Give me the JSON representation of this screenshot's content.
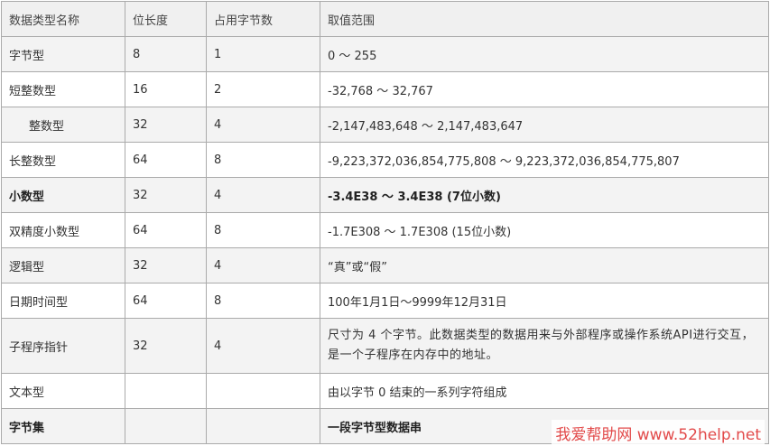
{
  "table": {
    "headers": [
      "数据类型名称",
      "位长度",
      "占用字节数",
      "取值范围"
    ],
    "rows": [
      {
        "name": "字节型",
        "bits": "8",
        "bytes": "1",
        "range": "0 ～ 255"
      },
      {
        "name": "短整数型",
        "bits": "16",
        "bytes": "2",
        "range": "-32,768 ～ 32,767"
      },
      {
        "name": "整数型",
        "bits": "32",
        "bytes": "4",
        "range": "-2,147,483,648 ～ 2,147,483,647"
      },
      {
        "name": "长整数型",
        "bits": "64",
        "bytes": "8",
        "range": "-9,223,372,036,854,775,808 ～ 9,223,372,036,854,775,807"
      },
      {
        "name": "小数型",
        "bits": "32",
        "bytes": "4",
        "range": "-3.4E38 ～ 3.4E38 (7位小数)"
      },
      {
        "name": "双精度小数型",
        "bits": "64",
        "bytes": "8",
        "range": "-1.7E308 ～ 1.7E308 (15位小数)"
      },
      {
        "name": "逻辑型",
        "bits": "32",
        "bytes": "4",
        "range": "“真”或“假”"
      },
      {
        "name": "日期时间型",
        "bits": "64",
        "bytes": "8",
        "range": "100年1月1日～9999年12月31日"
      },
      {
        "name": "子程序指针",
        "bits": "32",
        "bytes": "4",
        "range": "尺寸为 4 个字节。此数据类型的数据用来与外部程序或操作系统API进行交互，是一个子程序在内存中的地址。"
      },
      {
        "name": "文本型",
        "bits": "",
        "bytes": "",
        "range": "由以字节 0 结束的一系列字符组成"
      },
      {
        "name": "字节集",
        "bits": "",
        "bytes": "",
        "range": "一段字节型数据串"
      }
    ]
  },
  "watermark": {
    "text": "我爱帮助网 www.52help.net",
    "color": "#e24a4a"
  }
}
